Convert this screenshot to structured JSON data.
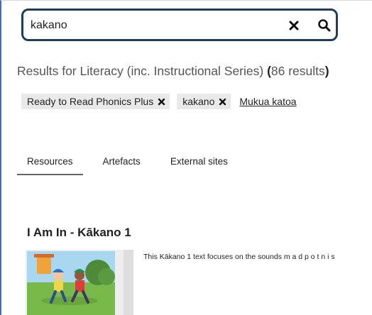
{
  "search": {
    "value": "kakano",
    "clear_icon": "close-icon",
    "search_icon": "search-icon"
  },
  "results": {
    "prefix": "Results for Literacy (inc. Instructional Series) ",
    "open_paren": "(",
    "count": "86 results",
    "close_paren": ")"
  },
  "filters": {
    "chips": [
      {
        "label": "Ready to Read Phonics Plus"
      },
      {
        "label": "kakano"
      }
    ],
    "clear_all": "Mukua katoa"
  },
  "tabs": [
    {
      "label": "Resources",
      "active": true
    },
    {
      "label": "Artefacts",
      "active": false
    },
    {
      "label": "External sites",
      "active": false
    }
  ],
  "result": {
    "title": "I Am In - Kākano 1",
    "description": "This Kākano 1 text focuses on the sounds m a d p o t n i s"
  },
  "colors": {
    "search_border": "#1f3d57",
    "chip_bg": "#e9e9e9",
    "frame_accent": "#3b6fb6"
  }
}
